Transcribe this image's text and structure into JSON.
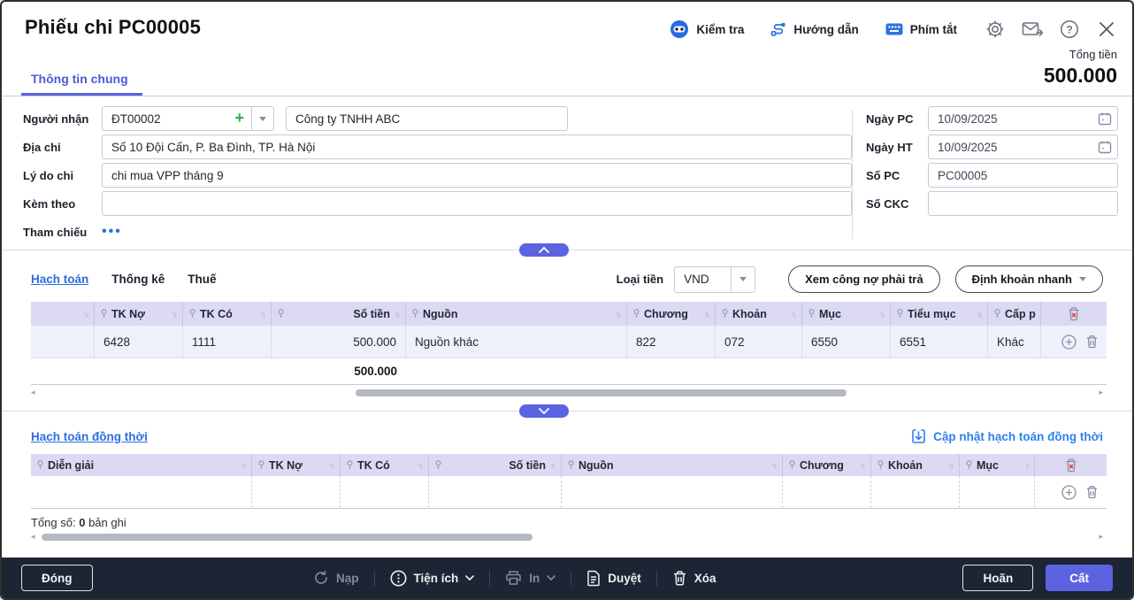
{
  "accent": "#5b63e0",
  "window_title": "Phiếu chi PC00005",
  "header": {
    "check_label": "Kiểm tra",
    "guide_label": "Hướng dẫn",
    "shortcut_label": "Phím tắt",
    "total_label": "Tổng tiền",
    "total_value": "500.000"
  },
  "tab_general": "Thông tin chung",
  "form": {
    "recipient_label": "Người nhận",
    "recipient_code": "ĐT00002",
    "recipient_name": "Công ty TNHH ABC",
    "address_label": "Địa chỉ",
    "address_value": "Số 10 Đội Cấn, P. Ba Đình, TP. Hà Nội",
    "reason_label": "Lý do chi",
    "reason_value": "chi mua VPP tháng 9",
    "attachment_label": "Kèm theo",
    "attachment_value": "",
    "reference_label": "Tham chiếu",
    "reference_dots": "•••",
    "date_pc_label": "Ngày PC",
    "date_pc_value": "10/09/2025",
    "date_ht_label": "Ngày HT",
    "date_ht_value": "10/09/2025",
    "no_pc_label": "Số PC",
    "no_pc_value": "PC00005",
    "no_ckc_label": "Số CKC",
    "no_ckc_value": ""
  },
  "detail": {
    "tab_accounting": "Hạch toán",
    "tab_stats": "Thống kê",
    "tab_tax": "Thuế",
    "currency_label": "Loại tiền",
    "currency_value": "VND",
    "btn_debt": "Xem công nợ phải trả",
    "btn_quick": "Định khoản nhanh"
  },
  "accounting_table": {
    "columns": [
      "TK Nợ",
      "TK Có",
      "Số tiền",
      "Nguồn",
      "Chương",
      "Khoản",
      "Mục",
      "Tiểu mục",
      "Cấp p"
    ],
    "row": {
      "tk_no": "6428",
      "tk_co": "1111",
      "so_tien": "500.000",
      "nguon": "Nguồn khác",
      "chuong": "822",
      "khoan": "072",
      "muc": "6550",
      "tieu_muc": "6551",
      "cap_phat": "Khác"
    },
    "total": "500.000"
  },
  "concurrent": {
    "title": "Hạch toán đồng thời",
    "update_link": "Cập nhật hạch toán đồng thời",
    "columns": [
      "Diễn giải",
      "TK Nợ",
      "TK Có",
      "Số tiền",
      "Nguồn",
      "Chương",
      "Khoản",
      "Mục"
    ],
    "total_prefix": "Tổng số:",
    "total_count": "0",
    "total_suffix": "bản ghi"
  },
  "footer": {
    "close": "Đóng",
    "reload": "Nạp",
    "utilities": "Tiện ích",
    "print": "In",
    "approve": "Duyệt",
    "delete": "Xóa",
    "postpone": "Hoãn",
    "save": "Cất"
  }
}
